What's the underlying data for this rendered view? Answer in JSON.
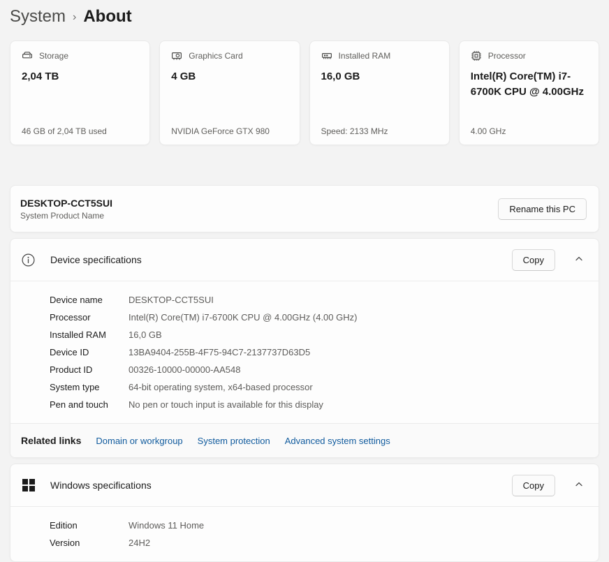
{
  "breadcrumb": {
    "parent": "System",
    "separator": "›",
    "current": "About"
  },
  "stat_cards": [
    {
      "icon": "storage-icon",
      "label": "Storage",
      "value": "2,04 TB",
      "detail": "46 GB of 2,04 TB used"
    },
    {
      "icon": "gpu-icon",
      "label": "Graphics Card",
      "value": "4 GB",
      "detail": "NVIDIA GeForce GTX 980"
    },
    {
      "icon": "ram-icon",
      "label": "Installed RAM",
      "value": "16,0 GB",
      "detail": "Speed: 2133 MHz"
    },
    {
      "icon": "processor-icon",
      "label": "Processor",
      "value": "Intel(R) Core(TM) i7-6700K CPU @ 4.00GHz",
      "detail": "4.00 GHz"
    }
  ],
  "device_card": {
    "name": "DESKTOP-CCT5SUI",
    "subtitle": "System Product Name",
    "rename_button": "Rename this PC"
  },
  "device_specs": {
    "title": "Device specifications",
    "copy_button": "Copy",
    "rows": [
      {
        "label": "Device name",
        "value": "DESKTOP-CCT5SUI"
      },
      {
        "label": "Processor",
        "value": "Intel(R) Core(TM) i7-6700K CPU @ 4.00GHz (4.00 GHz)"
      },
      {
        "label": "Installed RAM",
        "value": "16,0 GB"
      },
      {
        "label": "Device ID",
        "value": "13BA9404-255B-4F75-94C7-2137737D63D5"
      },
      {
        "label": "Product ID",
        "value": "00326-10000-00000-AA548"
      },
      {
        "label": "System type",
        "value": "64-bit operating system, x64-based processor"
      },
      {
        "label": "Pen and touch",
        "value": "No pen or touch input is available for this display"
      }
    ],
    "related": {
      "label": "Related links",
      "links": [
        "Domain or workgroup",
        "System protection",
        "Advanced system settings"
      ]
    }
  },
  "windows_specs": {
    "title": "Windows specifications",
    "copy_button": "Copy",
    "rows": [
      {
        "label": "Edition",
        "value": "Windows 11 Home"
      },
      {
        "label": "Version",
        "value": "24H2"
      }
    ]
  },
  "colors": {
    "accent_link": "#0f5a9d",
    "page_background": "#f3f3f3",
    "card_background": "#fdfdfd"
  }
}
